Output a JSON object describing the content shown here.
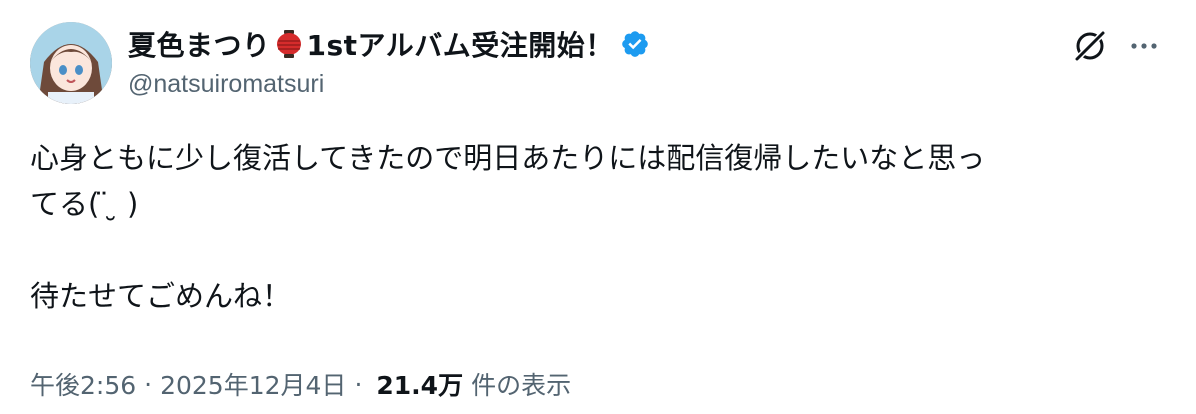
{
  "author": {
    "display_name_prefix": "夏色まつり",
    "display_name_suffix": "1stアルバム受注開始！",
    "handle": "@natsuiromatsuri",
    "avatar_icon": "anime-avatar-image",
    "lantern_icon": "red-paper-lantern-emoji",
    "verified_icon": "verified-badge-icon",
    "verified_color": "#1d9bf0"
  },
  "actions": {
    "grok_icon": "grok-icon",
    "more_icon": "more-options-icon"
  },
  "tweet": {
    "text": "心身ともに少し復活してきたので明日あたりには配信復帰したいなと思っ\nてる( ̈ ̮ )\n\n待たせてごめんね！"
  },
  "meta": {
    "time": "午後2:56",
    "separator": "·",
    "date": "2025年12月4日",
    "views_count": "21.4万",
    "views_label": "件の表示"
  }
}
